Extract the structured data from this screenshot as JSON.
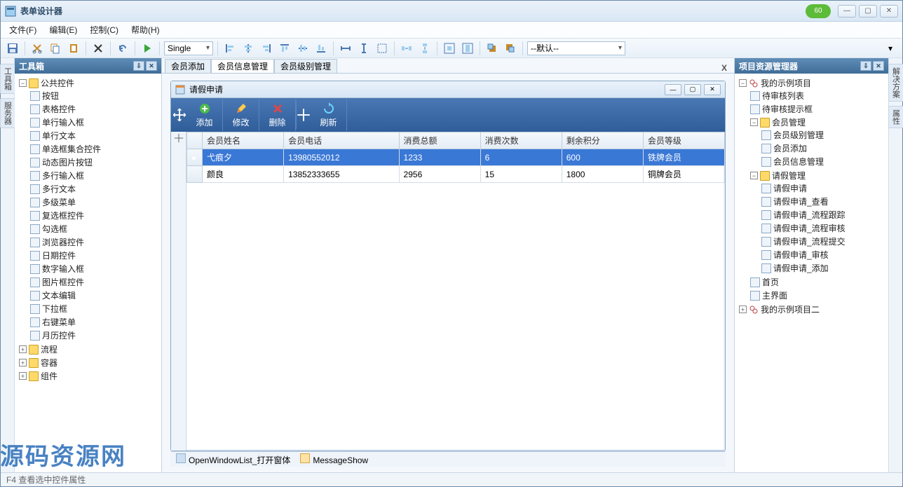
{
  "window": {
    "title": "表单设计器",
    "badge": "60"
  },
  "menu": {
    "file": "文件(F)",
    "edit": "编辑(E)",
    "control": "控制(C)",
    "help": "帮助(H)"
  },
  "toolbar": {
    "mode": "Single",
    "layout": "--默认--"
  },
  "toolbox": {
    "title": "工具箱",
    "root": "公共控件",
    "items": [
      "按钮",
      "表格控件",
      "单行输入框",
      "单行文本",
      "单选框集合控件",
      "动态图片按钮",
      "多行输入框",
      "多行文本",
      "多级菜单",
      "复选框控件",
      "勾选框",
      "浏览器控件",
      "日期控件",
      "数字输入框",
      "图片框控件",
      "文本编辑",
      "下拉框",
      "右键菜单",
      "月历控件"
    ],
    "groups": [
      "流程",
      "容器",
      "组件"
    ]
  },
  "left_tabs": {
    "toolbox": "工具箱",
    "server": "服务器"
  },
  "right_tabs": {
    "sol": "解决方案",
    "prop": "属性"
  },
  "docTabs": {
    "t1": "会员添加",
    "t2": "会员信息管理",
    "t3": "会员级别管理",
    "active": 1
  },
  "innerWindow": {
    "title": "请假申请",
    "buttons": {
      "add": "添加",
      "edit": "修改",
      "del": "删除",
      "refresh": "刷新"
    },
    "columns": [
      "会员姓名",
      "会员电话",
      "消费总额",
      "消费次数",
      "剩余积分",
      "会员等级"
    ],
    "rows": [
      {
        "name": "弋痕夕",
        "phone": "13980552012",
        "total": "1233",
        "count": "6",
        "points": "600",
        "level": "铁牌会员"
      },
      {
        "name": "颜良",
        "phone": "13852333655",
        "total": "2956",
        "count": "15",
        "points": "1800",
        "level": "铜牌会员"
      }
    ]
  },
  "status": {
    "s1": "OpenWindowList_打开窗体",
    "s2": "MessageShow"
  },
  "solution": {
    "title": "项目资源管理器",
    "proj1": "我的示例项目",
    "items1": [
      "待审核列表",
      "待审核提示框"
    ],
    "group_member": "会员管理",
    "member_items": [
      "会员级别管理",
      "会员添加",
      "会员信息管理"
    ],
    "group_leave": "请假管理",
    "leave_items": [
      "请假申请",
      "请假申请_查看",
      "请假申请_流程跟踪",
      "请假申请_流程审核",
      "请假申请_流程提交",
      "请假申请_审核",
      "请假申请_添加"
    ],
    "items2": [
      "首页",
      "主界面"
    ],
    "proj2": "我的示例项目二"
  },
  "footer": "F4 查看选中控件属性",
  "watermark": "源码资源网"
}
